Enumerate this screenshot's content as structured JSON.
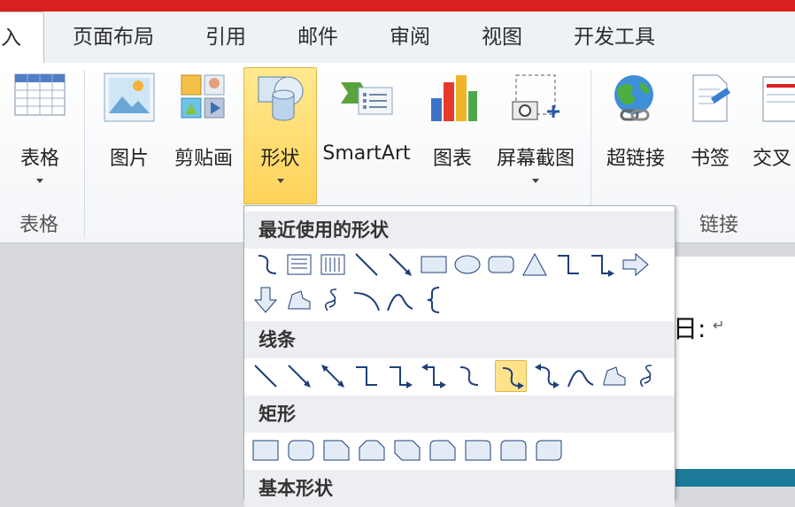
{
  "tabs": {
    "active": "入",
    "items": [
      "页面布局",
      "引用",
      "邮件",
      "审阅",
      "视图",
      "开发工具"
    ]
  },
  "ribbon": {
    "table_btn": "表格",
    "table_group": "表格",
    "picture_btn": "图片",
    "clipart_btn": "剪贴画",
    "shapes_btn": "形状",
    "smartart_btn": "SmartArt",
    "chart_btn": "图表",
    "screenshot_btn": "屏幕截图",
    "hyperlink_btn": "超链接",
    "bookmark_btn": "书签",
    "crossref_btn": "交叉",
    "links_group": "链接"
  },
  "dropdown": {
    "recent_title": "最近使用的形状",
    "lines_title": "线条",
    "rect_title": "矩形",
    "basic_title": "基本形状"
  },
  "document": {
    "text": "日:",
    "return_mark": "↵"
  },
  "colors": {
    "accent_red": "#d9201f",
    "selection": "#ffd35a"
  }
}
